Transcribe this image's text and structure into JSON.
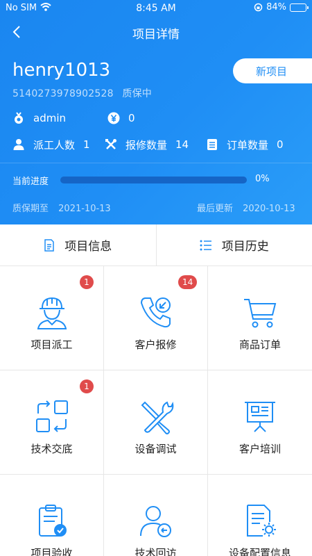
{
  "status_bar": {
    "carrier": "No SIM",
    "time": "8:45 AM",
    "battery": "84%",
    "battery_level": 0.84
  },
  "nav": {
    "title": "项目详情"
  },
  "project": {
    "name": "henry1013",
    "code": "5140273978902528",
    "status": "质保中",
    "new_button": "新项目",
    "owner": "admin",
    "amount": "0",
    "stats": [
      {
        "label": "派工人数",
        "value": "1"
      },
      {
        "label": "报修数量",
        "value": "14"
      },
      {
        "label": "订单数量",
        "value": "0"
      }
    ],
    "progress": {
      "label": "当前进度",
      "value": "0%",
      "fraction": 0
    },
    "warranty_label": "质保期至",
    "warranty_date": "2021-10-13",
    "updated_label": "最后更新",
    "updated_date": "2020-10-13"
  },
  "tabs": [
    {
      "label": "项目信息",
      "icon": "document-icon"
    },
    {
      "label": "项目历史",
      "icon": "history-list-icon"
    }
  ],
  "colors": {
    "primary": "#1f8ef5",
    "badge": "#e04b4b",
    "icon": "#1f8ef5"
  },
  "modules": [
    {
      "label": "项目派工",
      "icon": "worker-helmet-icon",
      "badge": "1"
    },
    {
      "label": "客户报修",
      "icon": "phone-call-icon",
      "badge": "14"
    },
    {
      "label": "商品订单",
      "icon": "shopping-cart-icon",
      "badge": ""
    },
    {
      "label": "技术交底",
      "icon": "exchange-blocks-icon",
      "badge": "1"
    },
    {
      "label": "设备调试",
      "icon": "tools-icon",
      "badge": ""
    },
    {
      "label": "客户培训",
      "icon": "presentation-board-icon",
      "badge": ""
    },
    {
      "label": "项目验收",
      "icon": "clipboard-check-icon",
      "badge": ""
    },
    {
      "label": "技术回访",
      "icon": "user-return-icon",
      "badge": ""
    },
    {
      "label": "设备配置信息",
      "icon": "document-gear-icon",
      "badge": ""
    }
  ]
}
